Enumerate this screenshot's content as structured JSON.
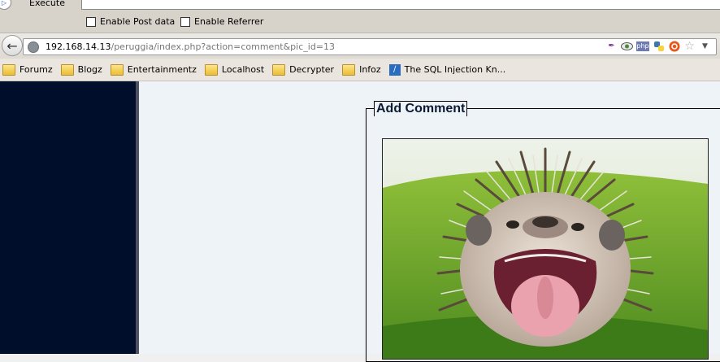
{
  "hackbar": {
    "execute_label": "Execute",
    "execute_input_value": "",
    "enable_post_label": "Enable Post data",
    "enable_referrer_label": "Enable Referrer",
    "enable_post_checked": false,
    "enable_referrer_checked": false
  },
  "urlbar": {
    "host": "192.168.14.13",
    "path": "/peruggia/index.php?action=comment&pic_id=13"
  },
  "toolbar_icons": [
    "feather-icon",
    "eye-icon",
    "php-icon",
    "python-icon",
    "ubuntu-icon",
    "star-icon",
    "dropdown-arrow-icon"
  ],
  "bookmarks": [
    {
      "label": "Forumz",
      "icon": "folder-icon"
    },
    {
      "label": "Blogz",
      "icon": "folder-icon"
    },
    {
      "label": "Entertainmentz",
      "icon": "folder-icon"
    },
    {
      "label": "Localhost",
      "icon": "folder-icon"
    },
    {
      "label": "Decrypter",
      "icon": "folder-icon"
    },
    {
      "label": "Infoz",
      "icon": "folder-icon"
    },
    {
      "label": "The SQL Injection Kn...",
      "icon": "sql-page-icon"
    }
  ],
  "page": {
    "legend": "Add Comment",
    "photo_subject": "hedgehog"
  },
  "colors": {
    "sidebar": "#000e2c",
    "content_bg": "#eef3f8",
    "legend_text": "#0b1a33"
  }
}
